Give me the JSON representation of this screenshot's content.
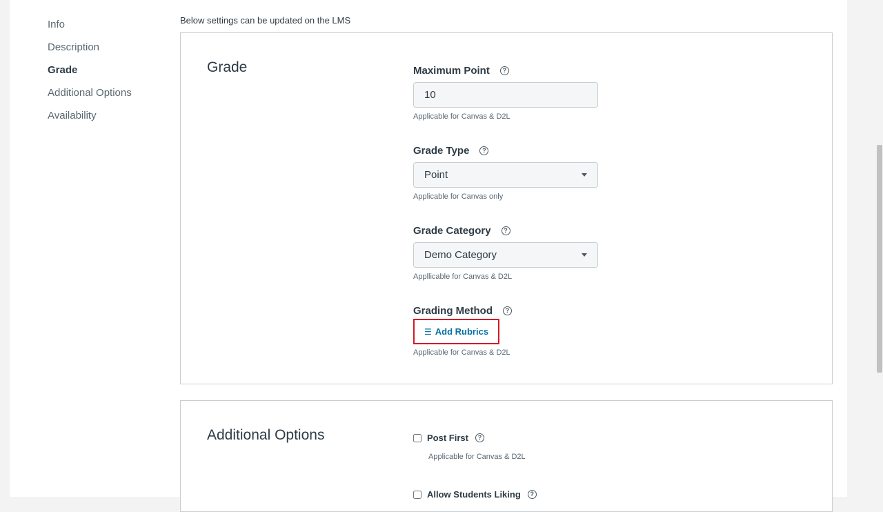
{
  "sidenav": {
    "items": [
      {
        "label": "Info"
      },
      {
        "label": "Description"
      },
      {
        "label": "Grade"
      },
      {
        "label": "Additional Options"
      },
      {
        "label": "Availability"
      }
    ]
  },
  "intro_text": "Below settings can be updated on the LMS",
  "grade": {
    "title": "Grade",
    "max_point": {
      "label": "Maximum Point",
      "value": "10",
      "hint": "Applicable for Canvas & D2L"
    },
    "grade_type": {
      "label": "Grade Type",
      "value": "Point",
      "hint": "Applicable for Canvas only"
    },
    "grade_category": {
      "label": "Grade Category",
      "value": "Demo Category",
      "hint": "Appllicable for Canvas & D2L"
    },
    "grading_method": {
      "label": "Grading Method",
      "button_label": "Add Rubrics",
      "hint": "Applicable for Canvas & D2L"
    }
  },
  "additional_options": {
    "title": "Additional Options",
    "post_first": {
      "label": "Post First",
      "hint": "Applicable for Canvas & D2L"
    },
    "allow_liking": {
      "label": "Allow Students Liking"
    }
  },
  "icons": {
    "help": "help-circle-icon",
    "rubric": "rubric-list-icon",
    "caret": "chevron-down-icon"
  },
  "colors": {
    "link": "#0770a3",
    "highlight": "#d11a24"
  }
}
